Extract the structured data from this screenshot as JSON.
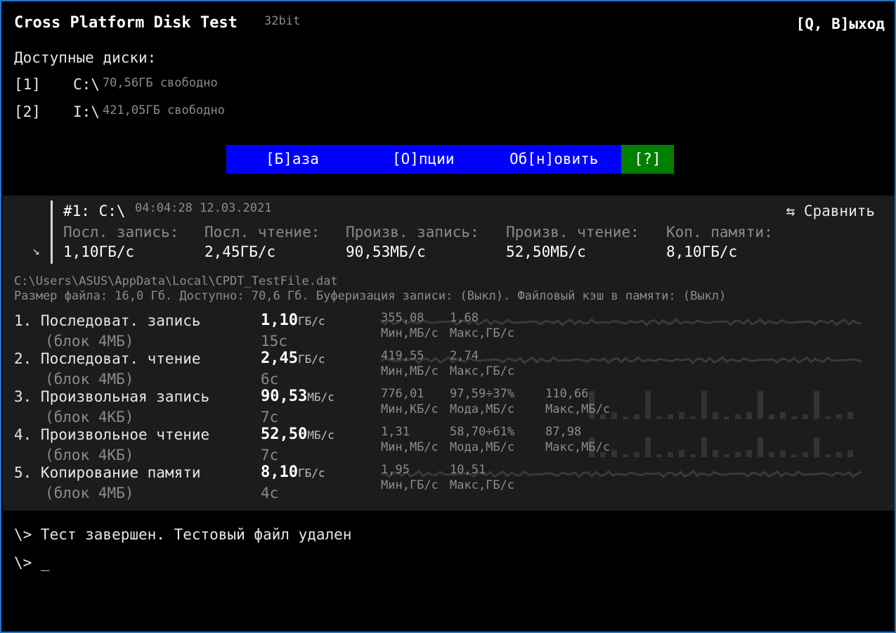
{
  "app": {
    "title": "Cross Platform Disk Test",
    "bits": "32bit",
    "exit_label": "[Q, В]ыход"
  },
  "drives": {
    "label": "Доступные диски:",
    "items": [
      {
        "index": "[1]",
        "path": "C:\\",
        "free": "70,56ГБ свободно"
      },
      {
        "index": "[2]",
        "path": "I:\\",
        "free": "421,05ГБ свободно"
      }
    ]
  },
  "menu": {
    "base": "[Б]аза",
    "options": "[О]пции",
    "refresh": "Об[н]овить",
    "help": "[?]"
  },
  "run": {
    "id": "#1: C:\\",
    "datetime": "04:04:28 12.03.2021",
    "compare_icon": "swap-arrows-icon",
    "compare": "⇆ Сравнить",
    "collapse_icon": "arrow-down-right-icon",
    "summary": [
      {
        "label": "Посл. запись:",
        "value": "1,10ГБ/с"
      },
      {
        "label": "Посл. чтение:",
        "value": "2,45ГБ/с"
      },
      {
        "label": "Произв. запись:",
        "value": "90,53МБ/с"
      },
      {
        "label": "Произв. чтение:",
        "value": "52,50МБ/с"
      },
      {
        "label": "Коп. памяти:",
        "value": "8,10ГБ/с"
      }
    ],
    "file_path": "C:\\Users\\ASUS\\AppData\\Local\\CPDT_TestFile.dat",
    "file_info": "Размер файла: 16,0 Гб. Доступно: 70,6 Гб. Буферизация записи: (Выкл). Файловый кэш в памяти: (Выкл)",
    "tests": [
      {
        "name": "1. Последоват. запись",
        "block": "(блок 4МБ)",
        "value": "1,10",
        "unit": "ГБ/с",
        "time": "15с",
        "stats": [
          {
            "v": "355,08",
            "l": "Мин,МБ/с"
          },
          {
            "v": "1,68",
            "l": "Макс,ГБ/с"
          }
        ]
      },
      {
        "name": "2. Последоват. чтение",
        "block": "(блок 4МБ)",
        "value": "2,45",
        "unit": "ГБ/с",
        "time": "6с",
        "stats": [
          {
            "v": "419,55",
            "l": "Мин,МБ/с"
          },
          {
            "v": "2,74",
            "l": "Макс,ГБ/с"
          }
        ]
      },
      {
        "name": "3. Произвольная запись",
        "block": "(блок 4КБ)",
        "value": "90,53",
        "unit": "МБ/с",
        "time": "7с",
        "stats": [
          {
            "v": "776,01",
            "l": "Мин,КБ/с"
          },
          {
            "v": "97,59÷37%",
            "l": "Мода,МБ/с"
          },
          {
            "v": "110,66",
            "l": "Макс,МБ/с"
          }
        ]
      },
      {
        "name": "4. Произвольное чтение",
        "block": "(блок 4КБ)",
        "value": "52,50",
        "unit": "МБ/с",
        "time": "7с",
        "stats": [
          {
            "v": "1,31",
            "l": "Мин,МБ/с"
          },
          {
            "v": "58,70÷61%",
            "l": "Мода,МБ/с"
          },
          {
            "v": "87,98",
            "l": "Макс,МБ/с"
          }
        ]
      },
      {
        "name": "5. Копирование памяти",
        "block": "(блок 4МБ)",
        "value": "8,10",
        "unit": "ГБ/с",
        "time": "4с",
        "stats": [
          {
            "v": "1,95",
            "l": "Мин,ГБ/с"
          },
          {
            "v": "10,51",
            "l": "Макс,ГБ/с"
          }
        ]
      }
    ]
  },
  "console": {
    "line1": "\\> Тест завершен. Тестовый файл удален",
    "line2": "\\> _"
  }
}
